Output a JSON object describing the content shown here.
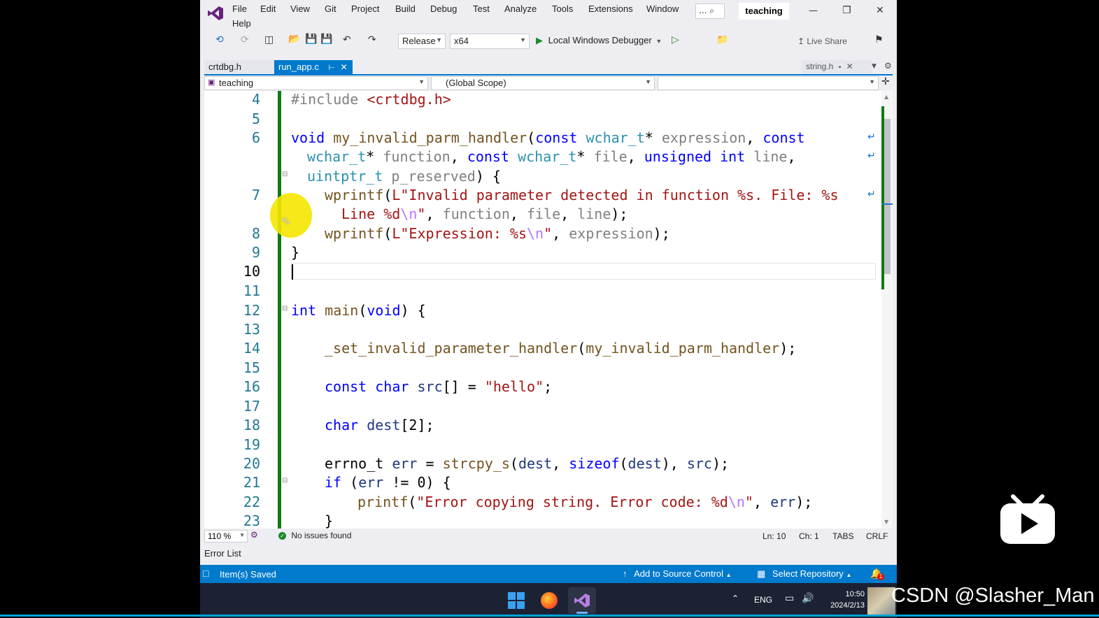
{
  "menu": [
    "File",
    "Edit",
    "View",
    "Git",
    "Project",
    "Build",
    "Debug",
    "Test",
    "Analyze",
    "Tools",
    "Extensions",
    "Window",
    "Help"
  ],
  "search_glyph": "... ⌕",
  "solution_name": "teaching",
  "window_controls": {
    "minimize": "—",
    "restore": "❐",
    "close": "✕"
  },
  "toolbar": {
    "config": "Release",
    "platform": "x64",
    "debugger": "Local Windows Debugger",
    "live_share": "Live Share"
  },
  "tabs": {
    "left": "crtdbg.h",
    "active": "run_app.c",
    "right": "string.h"
  },
  "nav": {
    "project": "teaching",
    "scope": "(Global Scope)",
    "member": ""
  },
  "line_numbers": [
    "4",
    "5",
    "6",
    "",
    "",
    "7",
    "",
    "8",
    "9",
    "10",
    "11",
    "12",
    "13",
    "14",
    "15",
    "16",
    "17",
    "18",
    "19",
    "20",
    "21",
    "22",
    "23"
  ],
  "status": {
    "zoom": "110 %",
    "issues": "No issues found",
    "ln": "Ln: 10",
    "ch": "Ch: 1",
    "tabs": "TABS",
    "eol": "CRLF"
  },
  "error_list": "Error List",
  "bottom_status": {
    "saved": "Item(s) Saved",
    "source_control": "Add to Source Control",
    "repository": "Select Repository",
    "notifications": "1"
  },
  "taskbar": {
    "lang": "ENG",
    "time": "10:50",
    "date": "2024/2/13"
  },
  "watermark": "CSDN @Slasher_Man",
  "colors": {
    "accent": "#007acc",
    "vs_purple": "#68217a",
    "change_bar": "#107c10",
    "cursor_highlight": "#f5e500"
  }
}
